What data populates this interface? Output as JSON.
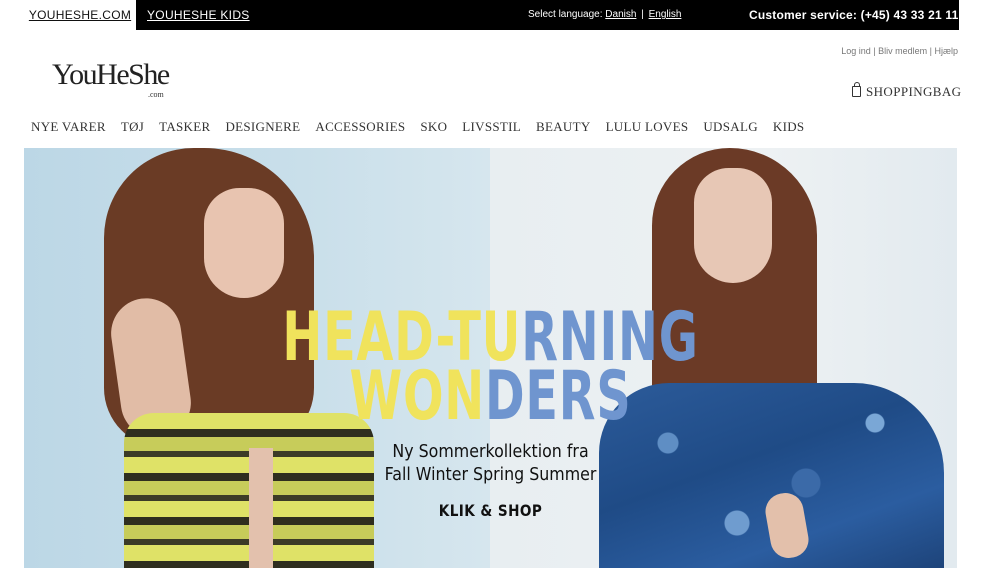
{
  "topbar": {
    "tab_main": "YOUHESHE.COM",
    "tab_kids": "YOUHESHE KIDS",
    "language_label": "Select language:",
    "language_danish": "Danish",
    "language_separator": "|",
    "language_english": "English",
    "customer_service": "Customer service: (+45) 43 33 21 11"
  },
  "header": {
    "account_links": [
      "Log ind",
      "Bliv medlem",
      "Hjælp"
    ],
    "logo_main": "YouHeShe",
    "logo_com": ".com",
    "shoppingbag": "SHOPPINGBAG",
    "shoppingbag_icon": "shopping-bag-icon"
  },
  "nav": {
    "items": [
      "NYE VARER",
      "TØJ",
      "TASKER",
      "DESIGNERE",
      "ACCESSORIES",
      "SKO",
      "LIVSSTIL",
      "BEAUTY",
      "LULU LOVES",
      "UDSALG",
      "KIDS"
    ]
  },
  "hero": {
    "headline_1a": "HEAD-TU",
    "headline_1b": "RNING",
    "headline_2a": "WON",
    "headline_2b": "DERS",
    "subtitle_1": "Ny Sommerkollektion fra",
    "subtitle_2": "Fall Winter Spring Summer",
    "cta": "KLIK & SHOP",
    "colors": {
      "yellow": "#f0e35c",
      "blue": "#6f95cf"
    }
  }
}
